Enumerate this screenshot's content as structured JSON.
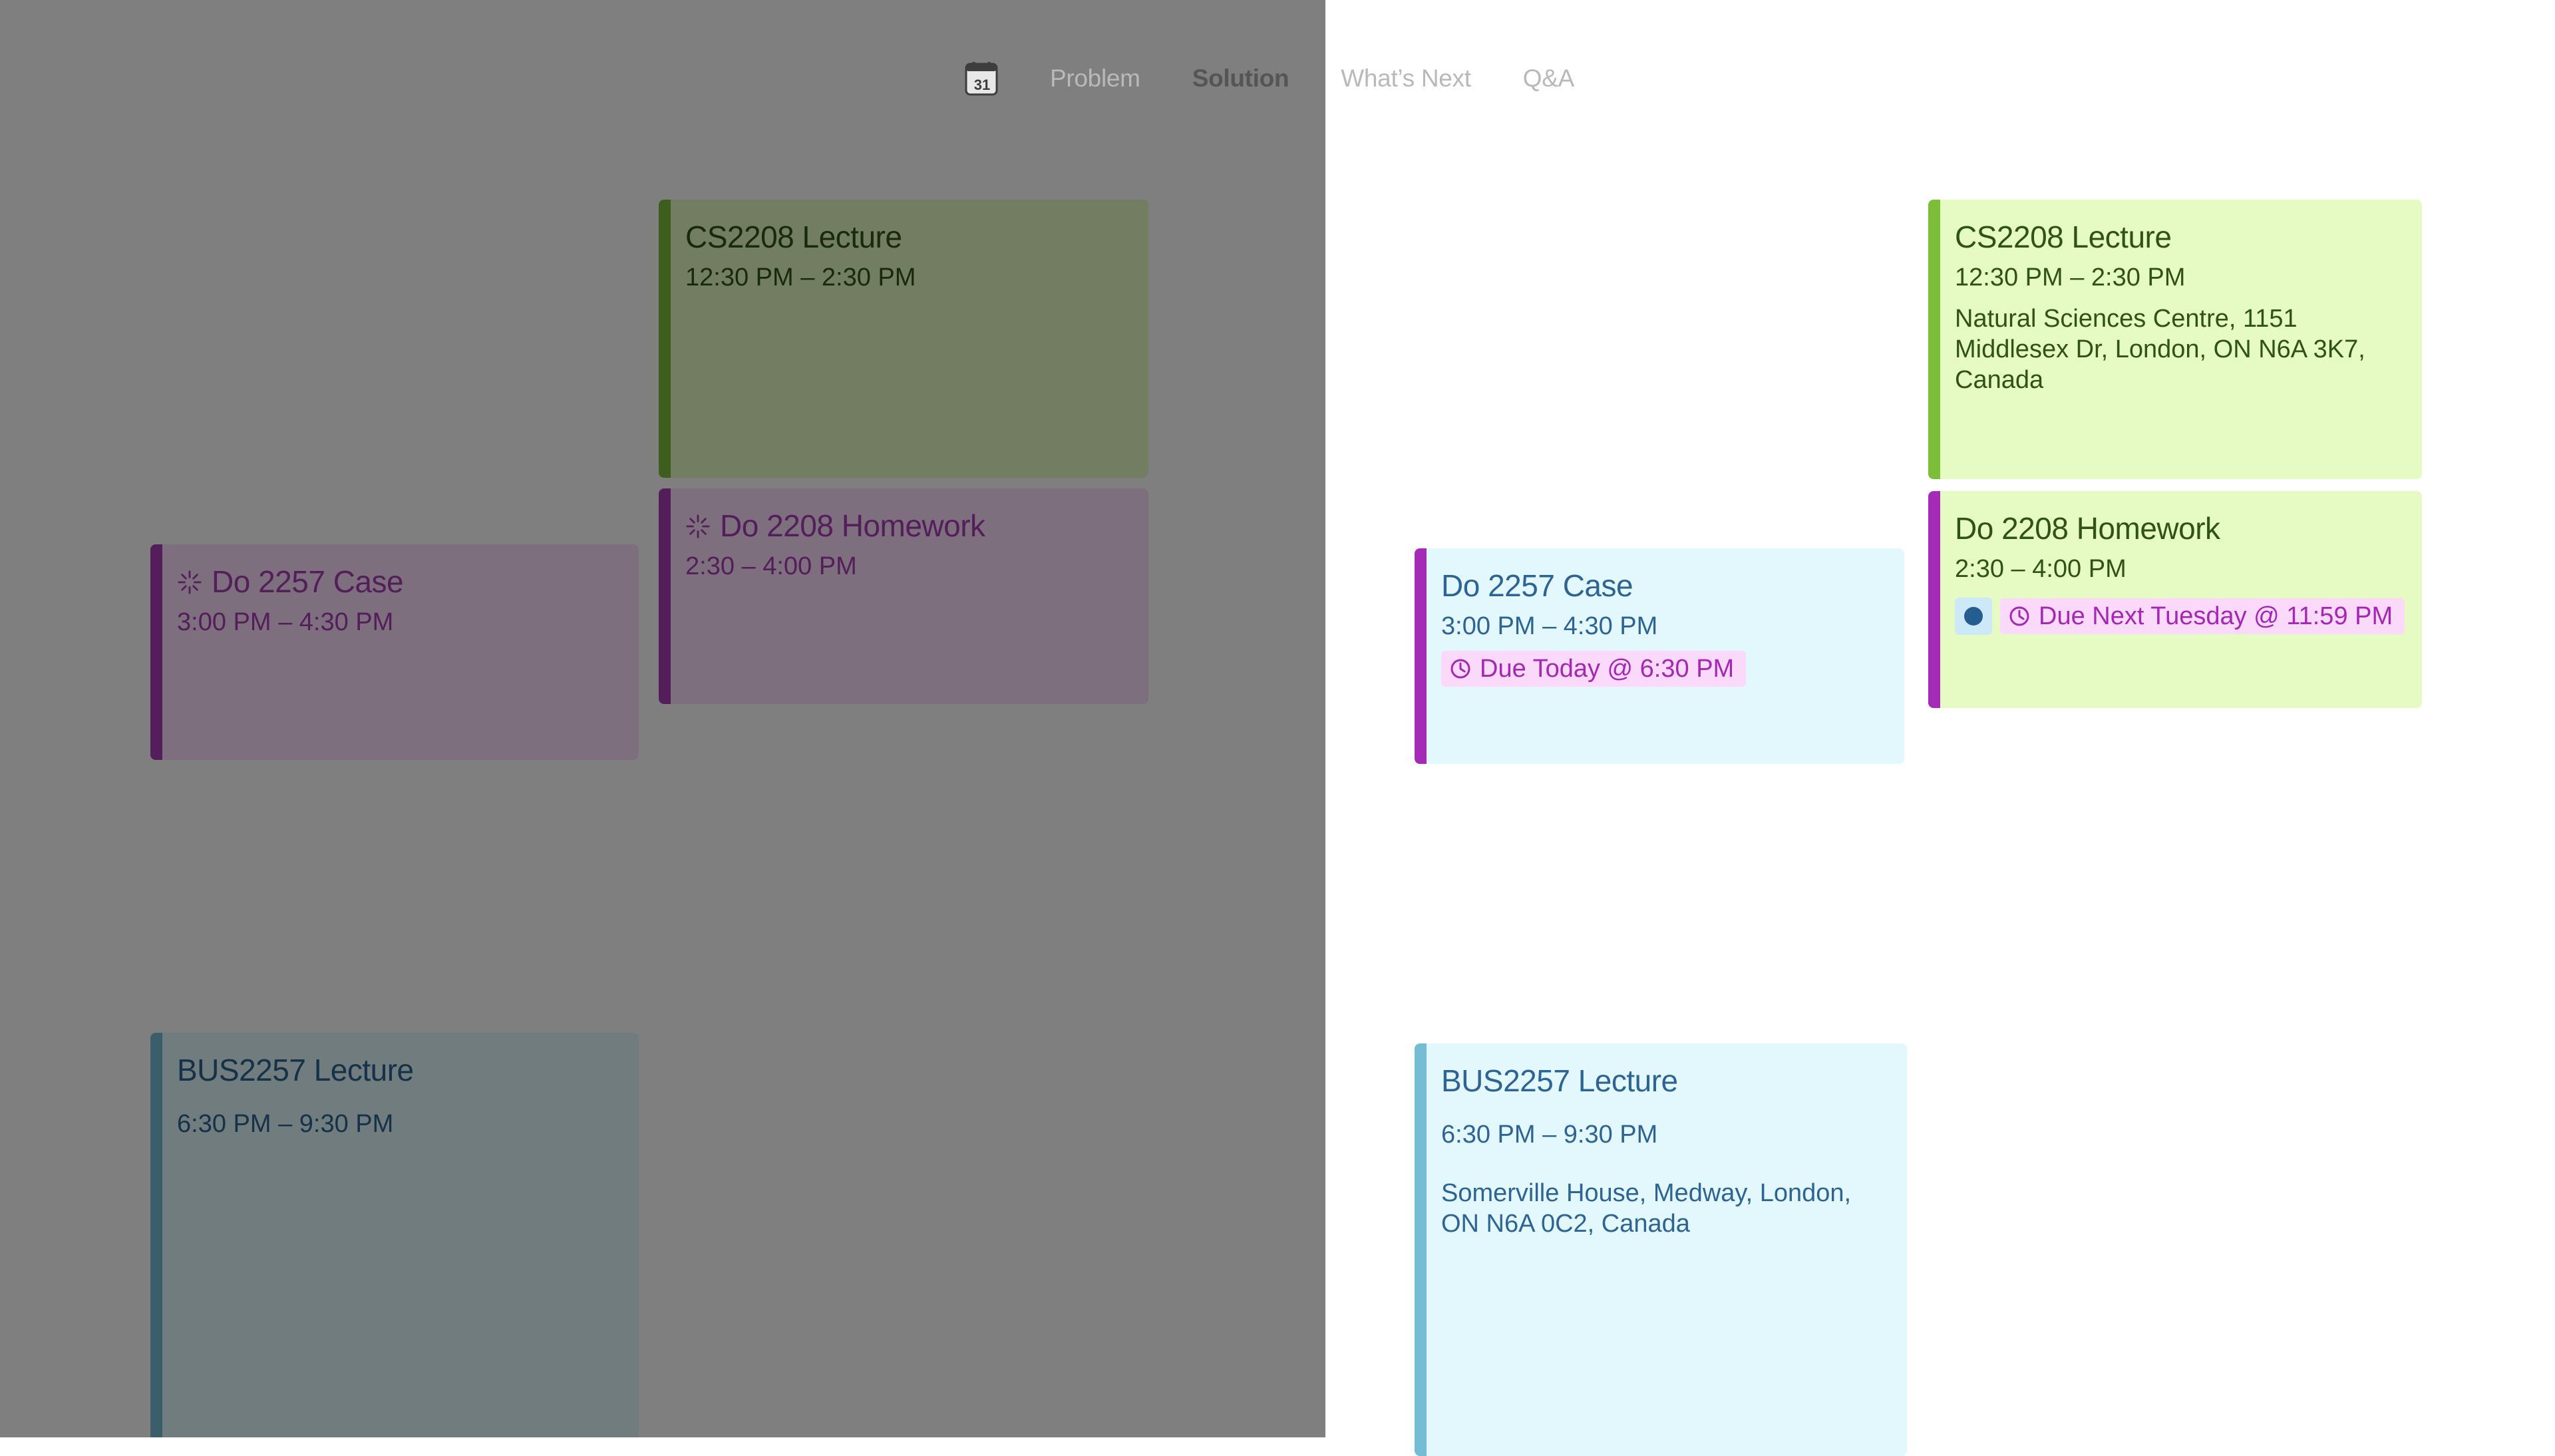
{
  "nav": {
    "logo_icon": "calendar-icon",
    "logo_number": "31",
    "items": [
      {
        "label": "Problem",
        "active": false
      },
      {
        "label": "Solution",
        "active": true
      },
      {
        "label": "What’s Next",
        "active": false
      },
      {
        "label": "Q&A",
        "active": false
      }
    ]
  },
  "before": {
    "events": [
      {
        "title": "CS2208 Lecture",
        "time": "12:30 PM – 2:30 PM",
        "color": "#7cbd3a"
      },
      {
        "title": "Do 2208 Homework",
        "time": "2:30 – 4:00 PM",
        "icon": "sparkle-icon",
        "color": "#a63db5"
      },
      {
        "title": "Do 2257 Case",
        "time": "3:00 PM – 4:30 PM",
        "icon": "sparkle-icon",
        "color": "#a63db5"
      },
      {
        "title": "BUS2257 Lecture",
        "time": "6:30 PM – 9:30 PM",
        "color": "#74bdd4"
      }
    ]
  },
  "after": {
    "events": [
      {
        "title": "CS2208 Lecture",
        "time": "12:30 PM – 2:30 PM",
        "location": "Natural Sciences Centre, 1151 Middlesex Dr, London, ON N6A 3K7, Canada",
        "color": "#7cbd3a"
      },
      {
        "title": "Do 2208 Homework",
        "time": "2:30 – 4:00 PM",
        "due": "Due Next Tuesday @ 11:59 PM",
        "badge_icon": "dot-icon",
        "color": "#a32bb5"
      },
      {
        "title": "Do 2257 Case",
        "time": "3:00 PM – 4:30 PM",
        "due": "Due Today @ 6:30 PM",
        "color": "#a32bb5"
      },
      {
        "title": "BUS2257 Lecture",
        "time": "6:30 PM – 9:30 PM",
        "location": "Somerville House, Medway, London, ON N6A 0C2, Canada",
        "color": "#74bdd4"
      }
    ]
  }
}
